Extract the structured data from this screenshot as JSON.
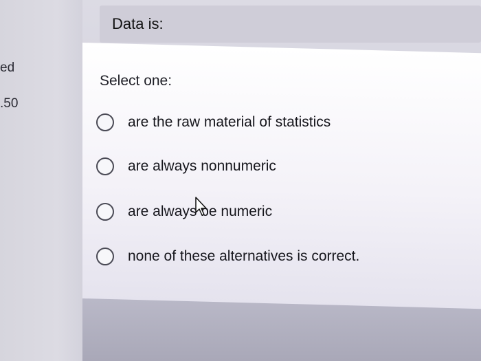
{
  "left_rail": {
    "fragment_1": "ed",
    "fragment_2": ".50"
  },
  "question": {
    "title": "Data is:",
    "prompt": "Select one:"
  },
  "options": [
    {
      "label": "are the raw material of statistics",
      "selected": false
    },
    {
      "label": "are always nonnumeric",
      "selected": false
    },
    {
      "label": "are always be numeric",
      "selected": false
    },
    {
      "label": "none of these alternatives is correct.",
      "selected": false
    }
  ],
  "cursor_icon": "arrow-pointer-icon"
}
